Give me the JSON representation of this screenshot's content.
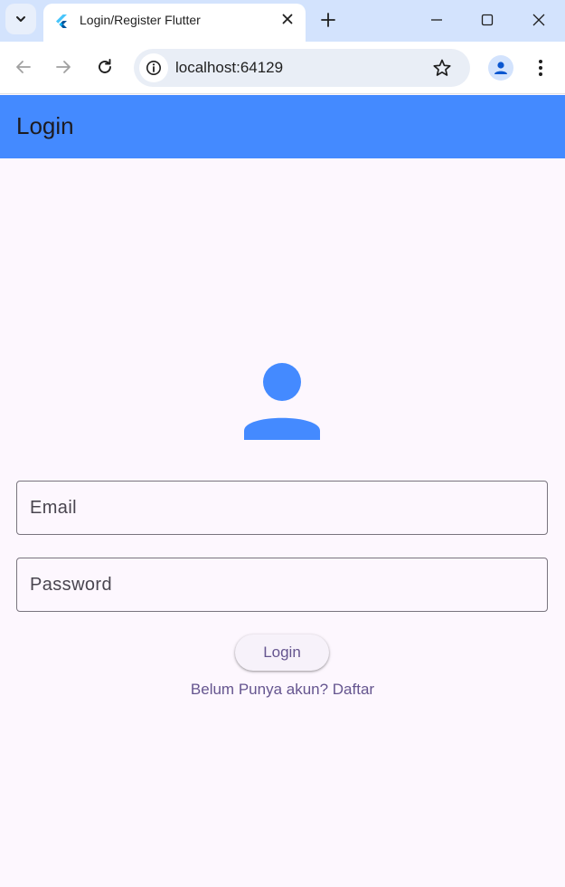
{
  "browser": {
    "tab_title": "Login/Register Flutter",
    "url": "localhost:64129",
    "favicon": "flutter-icon",
    "controls": [
      "tab-search-icon",
      "close-icon",
      "new-tab-icon",
      "minimize-icon",
      "maximize-icon",
      "window-close-icon",
      "back-icon",
      "forward-icon",
      "reload-icon",
      "site-info-icon",
      "star-icon",
      "profile-icon",
      "menu-icon"
    ]
  },
  "appbar": {
    "title": "Login",
    "color": "#448aff"
  },
  "form": {
    "avatar_icon": "person-icon",
    "email": {
      "placeholder": "Email",
      "value": ""
    },
    "password": {
      "placeholder": "Password",
      "value": ""
    },
    "login_label": "Login",
    "register_link": "Belum Punya akun? Daftar"
  },
  "colors": {
    "accent": "#448aff",
    "primary_text": "#65558f",
    "background": "#fdf7fe"
  }
}
